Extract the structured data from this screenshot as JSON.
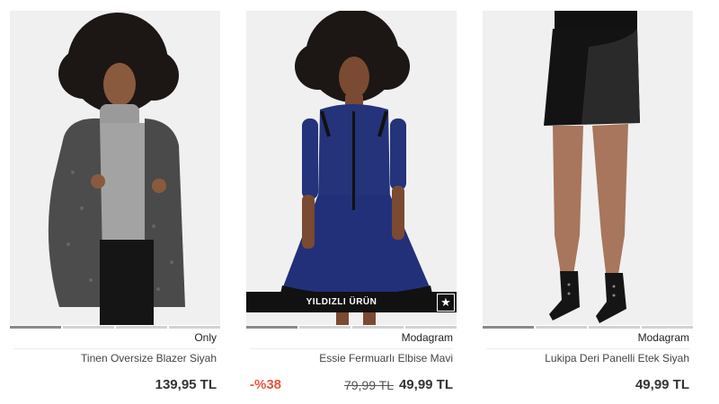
{
  "products": [
    {
      "brand": "Only",
      "title": "Tinen Oversize Blazer Siyah",
      "price": "139,95 TL",
      "image_icon": "model-photo-blazer"
    },
    {
      "brand": "Modagram",
      "title": "Essie Fermuarlı Elbise Mavi",
      "discount": "-%38",
      "old_price": "79,99 TL",
      "price": "49,99 TL",
      "badge": "YILDIZLI ÜRÜN",
      "badge_icon": "star-icon",
      "image_icon": "model-photo-dress"
    },
    {
      "brand": "Modagram",
      "title": "Lukipa Deri Panelli Etek Siyah",
      "price": "49,99 TL",
      "image_icon": "model-photo-skirt"
    }
  ],
  "colors": {
    "discount": "#e8553a",
    "badge_bg": "#111111"
  }
}
